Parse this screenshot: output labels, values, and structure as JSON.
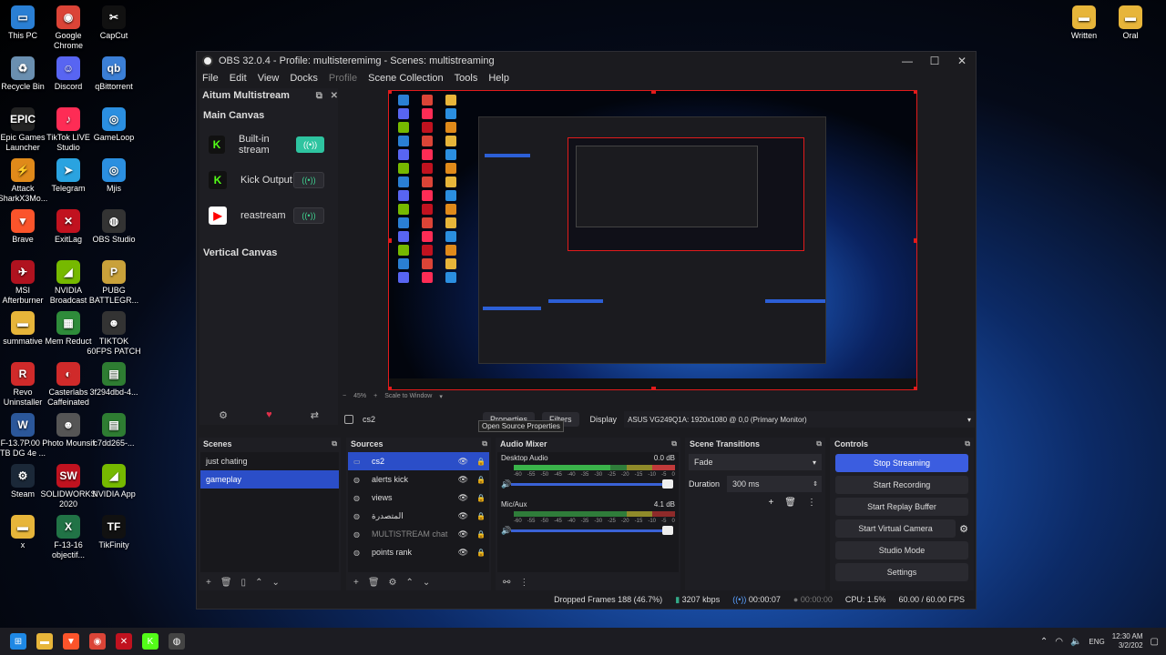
{
  "desktop": {
    "left_icons": [
      {
        "label": "This PC",
        "icon": "monitor-icon",
        "color": "#2a7fd4",
        "glyph": "▭"
      },
      {
        "label": "Google Chrome",
        "icon": "chrome-icon",
        "color": "#db4437",
        "glyph": "◉"
      },
      {
        "label": "CapCut",
        "icon": "capcut-icon",
        "color": "#111111",
        "glyph": "✂"
      },
      {
        "label": "Recycle Bin",
        "icon": "recycle-bin-icon",
        "color": "#6a8fb0",
        "glyph": "♻"
      },
      {
        "label": "Discord",
        "icon": "discord-icon",
        "color": "#5865f2",
        "glyph": "☺"
      },
      {
        "label": "qBittorrent",
        "icon": "qbittorrent-icon",
        "color": "#3b7fd6",
        "glyph": "qb"
      },
      {
        "label": "Epic Games Launcher",
        "icon": "epic-games-icon",
        "color": "#222222",
        "glyph": "EPIC"
      },
      {
        "label": "TikTok LIVE Studio",
        "icon": "tiktok-live-icon",
        "color": "#fe2c55",
        "glyph": "♪"
      },
      {
        "label": "GameLoop",
        "icon": "gameloop-icon",
        "color": "#2b8fe0",
        "glyph": "◎"
      },
      {
        "label": "Attack SharkX3Mo...",
        "icon": "attack-shark-icon",
        "color": "#e08a1a",
        "glyph": "⚡"
      },
      {
        "label": "Telegram",
        "icon": "telegram-icon",
        "color": "#2aa3e0",
        "glyph": "➤"
      },
      {
        "label": "Mjis",
        "icon": "mjis-icon",
        "color": "#2b8fe0",
        "glyph": "◎"
      },
      {
        "label": "Brave",
        "icon": "brave-icon",
        "color": "#fb542b",
        "glyph": "▼"
      },
      {
        "label": "ExitLag",
        "icon": "exitlag-icon",
        "color": "#c1121f",
        "glyph": "✕"
      },
      {
        "label": "OBS Studio",
        "icon": "obs-studio-icon",
        "color": "#333333",
        "glyph": "◍"
      },
      {
        "label": "MSI Afterburner",
        "icon": "msi-afterburner-icon",
        "color": "#b0121f",
        "glyph": "✈"
      },
      {
        "label": "NVIDIA Broadcast",
        "icon": "nvidia-broadcast-icon",
        "color": "#76b900",
        "glyph": "◢"
      },
      {
        "label": "PUBG BATTLEGR...",
        "icon": "pubg-icon",
        "color": "#c9a13a",
        "glyph": "P"
      },
      {
        "label": "summative",
        "icon": "folder-icon",
        "color": "#e7b53a",
        "glyph": "▬"
      },
      {
        "label": "Mem Reduct",
        "icon": "mem-reduct-icon",
        "color": "#2e8b3a",
        "glyph": "▦"
      },
      {
        "label": "TIKTOK 60FPS PATCH",
        "icon": "tiktok-patch-icon",
        "color": "#333333",
        "glyph": "☻"
      },
      {
        "label": "Revo Uninstaller",
        "icon": "revo-uninstaller-icon",
        "color": "#d02a2a",
        "glyph": "R"
      },
      {
        "label": "Casterlabs Caffeinated",
        "icon": "casterlabs-icon",
        "color": "#d02a2a",
        "glyph": "◐"
      },
      {
        "label": "3f294dbd-4...",
        "icon": "file-icon",
        "color": "#2e7d32",
        "glyph": "▤"
      },
      {
        "label": "F-13.7P.00 - TB DG 4e ...",
        "icon": "word-doc-icon",
        "color": "#2b579a",
        "glyph": "W"
      },
      {
        "label": "Photo Mounsif",
        "icon": "photo-icon",
        "color": "#555555",
        "glyph": "☻"
      },
      {
        "label": "c7dd265-...",
        "icon": "file-icon",
        "color": "#2e7d32",
        "glyph": "▤"
      },
      {
        "label": "Steam",
        "icon": "steam-icon",
        "color": "#1b2838",
        "glyph": "⚙"
      },
      {
        "label": "SOLIDWORKS 2020",
        "icon": "solidworks-icon",
        "color": "#c1121f",
        "glyph": "SW"
      },
      {
        "label": "NVIDIA App",
        "icon": "nvidia-app-icon",
        "color": "#76b900",
        "glyph": "◢"
      },
      {
        "label": "x",
        "icon": "folder-icon",
        "color": "#e7b53a",
        "glyph": "▬"
      },
      {
        "label": "F-13-16 objectif...",
        "icon": "excel-icon",
        "color": "#217346",
        "glyph": "X"
      },
      {
        "label": "TikFinity",
        "icon": "tikfinity-icon",
        "color": "#111111",
        "glyph": "TF"
      }
    ],
    "right_icons": [
      {
        "label": "Written",
        "icon": "folder-icon",
        "color": "#e7b53a",
        "glyph": "▬"
      },
      {
        "label": "Oral",
        "icon": "folder-icon",
        "color": "#e7b53a",
        "glyph": "▬"
      }
    ]
  },
  "window": {
    "title": "OBS 32.0.4 - Profile: multisteremimg - Scenes: multistreaming",
    "controls": {
      "minimize": "—",
      "maximize": "☐",
      "close": "✕"
    }
  },
  "menu": [
    "File",
    "Edit",
    "View",
    "Docks",
    "Profile",
    "Scene Collection",
    "Tools",
    "Help"
  ],
  "multistream": {
    "title": "Aitum Multistream",
    "header_icons": {
      "float": "⧉",
      "close": "✕"
    },
    "main_canvas_title": "Main Canvas",
    "outputs": [
      {
        "name": "Built-in stream",
        "platform_glyph": "K",
        "platform_color": "#53fc18",
        "platform_icon": "kick-icon",
        "active": true
      },
      {
        "name": "Kick Output",
        "platform_glyph": "K",
        "platform_color": "#53fc18",
        "platform_icon": "kick-icon",
        "active": false
      },
      {
        "name": "reastream",
        "platform_glyph": "▶",
        "platform_color": "#ff0000",
        "platform_icon": "youtube-icon",
        "active": false
      }
    ],
    "toggle_glyph": "((•))",
    "vertical_canvas_title": "Vertical Canvas",
    "footer_icons": {
      "settings": "⚙",
      "heart": "♥",
      "links": "⇄"
    }
  },
  "preview": {
    "zoom": "45%",
    "scale_mode": "Scale to Window"
  },
  "source_toolbar": {
    "selected_source": "cs2",
    "properties_label": "Properties",
    "filters_label": "Filters",
    "display_label": "Display",
    "display_value": "ASUS VG249Q1A: 1920x1080 @ 0,0 (Primary Monitor)",
    "tooltip": "Open Source Properties"
  },
  "scenes": {
    "title": "Scenes",
    "items": [
      {
        "name": "just chating",
        "selected": false
      },
      {
        "name": "gameplay",
        "selected": true
      }
    ],
    "footer": {
      "add": "+",
      "remove": "🗑",
      "filter": "▯",
      "up": "⌃",
      "down": "⌄"
    }
  },
  "sources": {
    "title": "Sources",
    "items": [
      {
        "name": "cs2",
        "icon": "▭",
        "selected": true,
        "dimmed": false
      },
      {
        "name": "alerts kick",
        "icon": "◍",
        "selected": false,
        "dimmed": false
      },
      {
        "name": "views",
        "icon": "◍",
        "selected": false,
        "dimmed": false
      },
      {
        "name": "المتصدرة",
        "icon": "◍",
        "selected": false,
        "dimmed": false
      },
      {
        "name": "MULTISTREAM chat",
        "icon": "◍",
        "selected": false,
        "dimmed": true
      },
      {
        "name": "points rank",
        "icon": "◍",
        "selected": false,
        "dimmed": false
      }
    ],
    "footer": {
      "add": "+",
      "remove": "🗑",
      "settings": "⚙",
      "up": "⌃",
      "down": "⌄"
    }
  },
  "audio_mixer": {
    "title": "Audio Mixer",
    "channels": [
      {
        "name": "Desktop Audio",
        "level": "0.0 dB",
        "volume_percent": 100
      },
      {
        "name": "Mic/Aux",
        "level": "4.1 dB",
        "volume_percent": 100
      }
    ],
    "scale": [
      "-60",
      "-55",
      "-50",
      "-45",
      "-40",
      "-35",
      "-30",
      "-25",
      "-20",
      "-15",
      "-10",
      "-5",
      "0"
    ],
    "footer": {
      "link": "⚯",
      "more": "⋮"
    }
  },
  "transitions": {
    "title": "Scene Transitions",
    "transition": "Fade",
    "duration_label": "Duration",
    "duration": "300 ms"
  },
  "controls": {
    "title": "Controls",
    "buttons": [
      {
        "label": "Stop Streaming",
        "active": true
      },
      {
        "label": "Start Recording",
        "active": false
      },
      {
        "label": "Start Replay Buffer",
        "active": false
      },
      {
        "label": "Start Virtual Camera",
        "active": false
      },
      {
        "label": "Studio Mode",
        "active": false
      },
      {
        "label": "Settings",
        "active": false
      }
    ]
  },
  "status": {
    "dropped_frames": "Dropped Frames 188 (46.7%)",
    "bitrate": "3207 kbps",
    "stream_time": "00:00:07",
    "record_time": "00:00:00",
    "cpu": "CPU: 1.5%",
    "fps": "60.00 / 60.00 FPS"
  },
  "taskbar": {
    "apps": [
      {
        "name": "start",
        "glyph": "⊞",
        "color": "#1e88e5",
        "icon": "windows-start-icon"
      },
      {
        "name": "file-explorer",
        "glyph": "▬",
        "color": "#e7b53a",
        "icon": "file-explorer-icon"
      },
      {
        "name": "brave",
        "glyph": "▼",
        "color": "#fb542b",
        "icon": "brave-icon"
      },
      {
        "name": "chrome",
        "glyph": "◉",
        "color": "#db4437",
        "icon": "chrome-icon"
      },
      {
        "name": "exitlag",
        "glyph": "✕",
        "color": "#c1121f",
        "icon": "exitlag-icon"
      },
      {
        "name": "kick",
        "glyph": "K",
        "color": "#53fc18",
        "icon": "kick-icon"
      },
      {
        "name": "obs",
        "glyph": "◍",
        "color": "#444444",
        "icon": "obs-studio-icon"
      }
    ],
    "language": "ENG",
    "time": "12:30 AM",
    "date": "3/2/202"
  }
}
